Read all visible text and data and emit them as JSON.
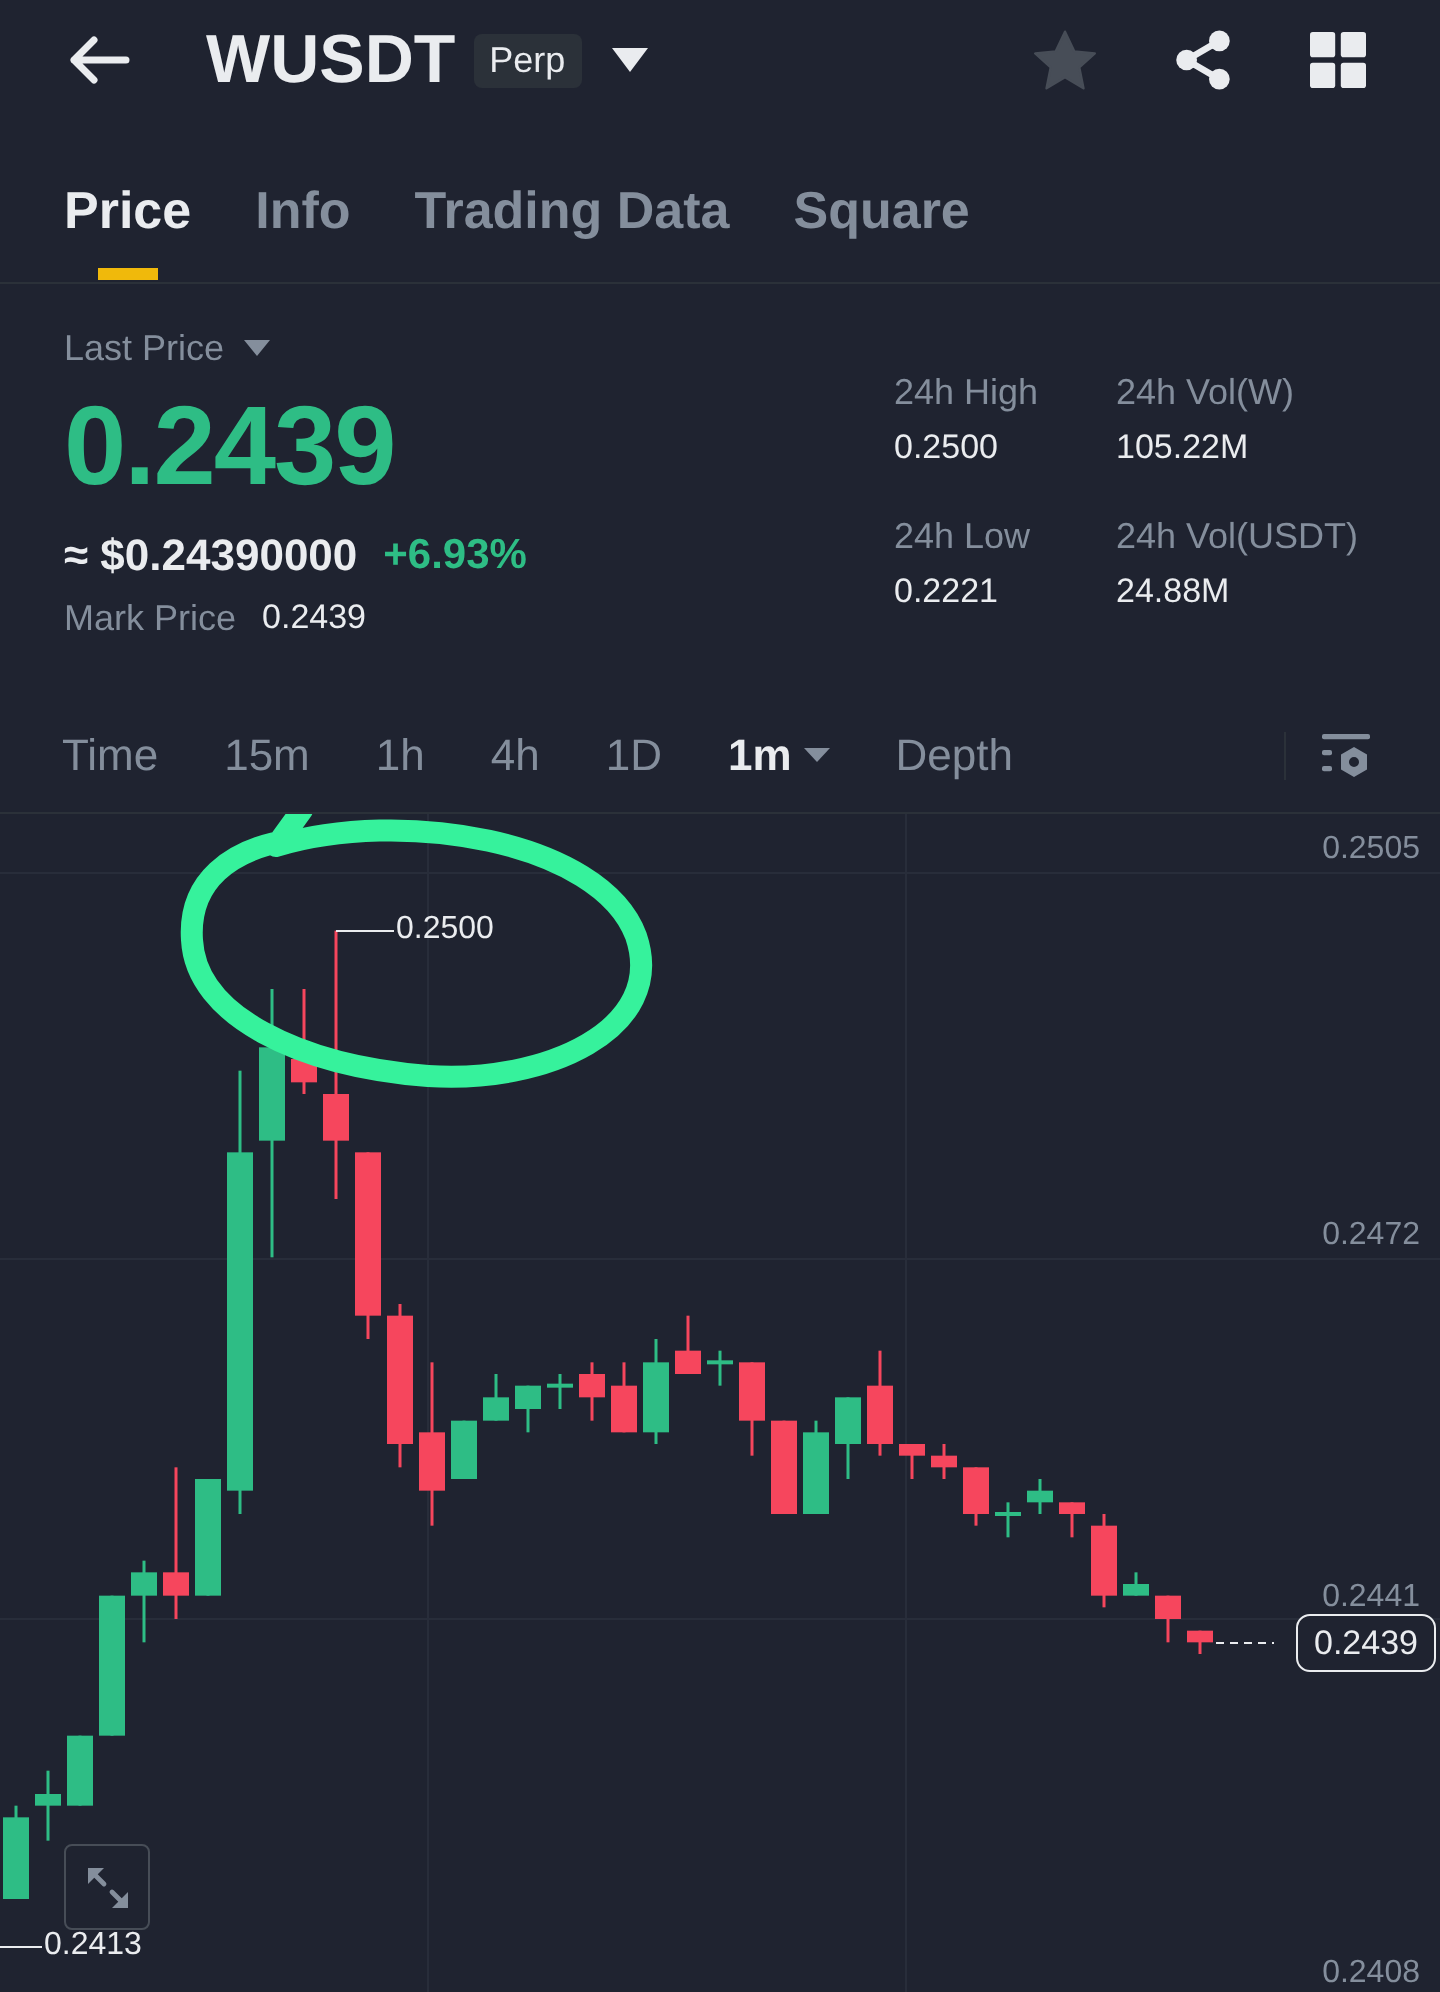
{
  "header": {
    "symbol": "WUSDT",
    "badge": "Perp",
    "favorited": false
  },
  "tabs": [
    {
      "label": "Price",
      "selected": true
    },
    {
      "label": "Info",
      "selected": false
    },
    {
      "label": "Trading Data",
      "selected": false
    },
    {
      "label": "Square",
      "selected": false
    }
  ],
  "price_panel": {
    "last_price_label": "Last Price",
    "last_price": "0.2439",
    "approx_usd": "≈ $0.24390000",
    "change": "+6.93%",
    "mark_price_label": "Mark Price",
    "mark_price": "0.2439"
  },
  "stats": [
    {
      "label": "24h High",
      "value": "0.2500"
    },
    {
      "label": "24h Vol(W)",
      "value": "105.22M"
    },
    {
      "label": "24h Low",
      "value": "0.2221"
    },
    {
      "label": "24h Vol(USDT)",
      "value": "24.88M"
    }
  ],
  "intervals": [
    {
      "label": "Time",
      "selected": false,
      "dropdown": false
    },
    {
      "label": "15m",
      "selected": false,
      "dropdown": false
    },
    {
      "label": "1h",
      "selected": false,
      "dropdown": false
    },
    {
      "label": "4h",
      "selected": false,
      "dropdown": false
    },
    {
      "label": "1D",
      "selected": false,
      "dropdown": false
    },
    {
      "label": "1m",
      "selected": true,
      "dropdown": true
    },
    {
      "label": "Depth",
      "selected": false,
      "dropdown": false
    }
  ],
  "chart": {
    "chart_data": {
      "type": "candlestick",
      "ohlc": [
        [
          0.2417,
          0.2425,
          0.2417,
          0.2424
        ],
        [
          0.2425,
          0.2428,
          0.2422,
          0.2426
        ],
        [
          0.2425,
          0.2431,
          0.2425,
          0.2431
        ],
        [
          0.2431,
          0.2443,
          0.2431,
          0.2443
        ],
        [
          0.2443,
          0.2446,
          0.2439,
          0.2445
        ],
        [
          0.2445,
          0.2454,
          0.2441,
          0.2443
        ],
        [
          0.2443,
          0.2453,
          0.2443,
          0.2453
        ],
        [
          0.2452,
          0.2488,
          0.245,
          0.2481
        ],
        [
          0.2482,
          0.2495,
          0.2472,
          0.249
        ],
        [
          0.2489,
          0.2495,
          0.2486,
          0.2487
        ],
        [
          0.2486,
          0.25,
          0.2477,
          0.2482
        ],
        [
          0.2481,
          0.2481,
          0.2465,
          0.2467
        ],
        [
          0.2467,
          0.2468,
          0.2454,
          0.2456
        ],
        [
          0.2457,
          0.2463,
          0.2449,
          0.2452
        ],
        [
          0.2453,
          0.2458,
          0.2453,
          0.2458
        ],
        [
          0.2458,
          0.2462,
          0.2458,
          0.246
        ],
        [
          0.2459,
          0.2461,
          0.2457,
          0.2461
        ],
        [
          0.2461,
          0.2462,
          0.2459,
          0.2461
        ],
        [
          0.2462,
          0.2463,
          0.2458,
          0.246
        ],
        [
          0.2461,
          0.2463,
          0.2457,
          0.2457
        ],
        [
          0.2457,
          0.2465,
          0.2456,
          0.2463
        ],
        [
          0.2464,
          0.2467,
          0.2462,
          0.2462
        ],
        [
          0.2463,
          0.2464,
          0.2461,
          0.2463
        ],
        [
          0.2463,
          0.2463,
          0.2455,
          0.2458
        ],
        [
          0.2458,
          0.2458,
          0.245,
          0.245
        ],
        [
          0.245,
          0.2458,
          0.245,
          0.2457
        ],
        [
          0.2456,
          0.246,
          0.2453,
          0.246
        ],
        [
          0.2461,
          0.2464,
          0.2455,
          0.2456
        ],
        [
          0.2456,
          0.2456,
          0.2453,
          0.2455
        ],
        [
          0.2455,
          0.2456,
          0.2453,
          0.2454
        ],
        [
          0.2454,
          0.2454,
          0.2449,
          0.245
        ],
        [
          0.245,
          0.2451,
          0.2448,
          0.245
        ],
        [
          0.2451,
          0.2453,
          0.245,
          0.2452
        ],
        [
          0.2451,
          0.2451,
          0.2448,
          0.245
        ],
        [
          0.2449,
          0.245,
          0.2442,
          0.2443
        ],
        [
          0.2443,
          0.2445,
          0.2443,
          0.2444
        ],
        [
          0.2443,
          0.2443,
          0.2439,
          0.2441
        ],
        [
          0.244,
          0.244,
          0.2438,
          0.2439
        ]
      ],
      "ylim": [
        0.2408,
        0.251
      ],
      "yticks": [
        0.2505,
        0.2472,
        0.2441,
        0.2408
      ],
      "grid": true,
      "annotations": [
        "0.2500",
        "0.2413",
        "0.2439"
      ]
    }
  }
}
